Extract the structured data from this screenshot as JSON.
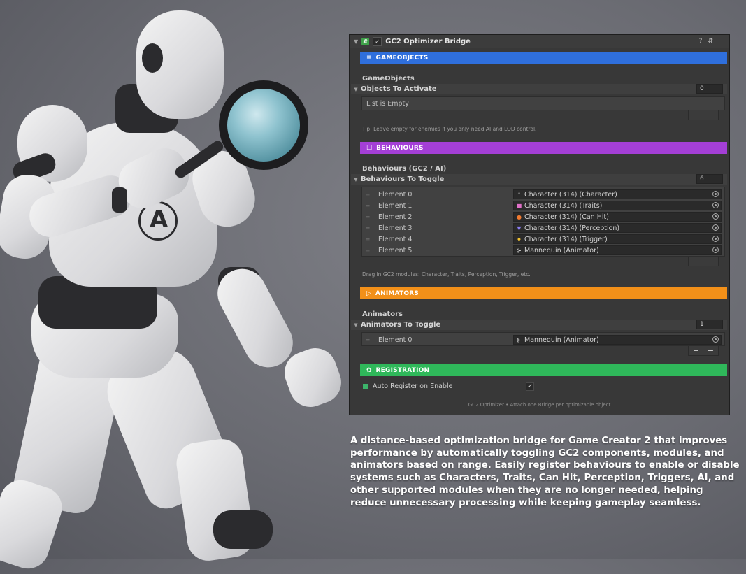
{
  "component": {
    "title": "GC2 Optimizer Bridge",
    "header_icons": [
      "help-icon",
      "preset-icon",
      "more-icon"
    ]
  },
  "sections": {
    "gameobjects": {
      "label": "GAMEOBJECTS",
      "icon": "list-icon",
      "color": "#2f6fdc"
    },
    "behaviours": {
      "label": "BEHAVIOURS",
      "icon": "square-icon",
      "color": "#a43fd6"
    },
    "animators": {
      "label": "ANIMATORS",
      "icon": "play-icon",
      "color": "#f29019"
    },
    "registration": {
      "label": "REGISTRATION",
      "icon": "gear-icon",
      "color": "#2fb85a"
    }
  },
  "gameobjects": {
    "heading": "GameObjects",
    "list_label": "Objects To Activate",
    "count": "0",
    "empty_text": "List is Empty",
    "tip": "Tip: Leave empty for enemies if you only need AI and LOD control."
  },
  "behaviours": {
    "heading": "Behaviours (GC2 / AI)",
    "list_label": "Behaviours To Toggle",
    "count": "6",
    "items": [
      {
        "name": "Element 0",
        "value": "Character (314) (Character)",
        "icon": "character-icon",
        "glyph": "☨",
        "color": "#dcdcdc"
      },
      {
        "name": "Element 1",
        "value": "Character (314) (Traits)",
        "icon": "traits-icon",
        "glyph": "■",
        "color": "#e070c8"
      },
      {
        "name": "Element 2",
        "value": "Character (314) (Can Hit)",
        "icon": "can-hit-icon",
        "glyph": "●",
        "color": "#f07a30"
      },
      {
        "name": "Element 3",
        "value": "Character (314) (Perception)",
        "icon": "perception-icon",
        "glyph": "▼",
        "color": "#8a7cf0"
      },
      {
        "name": "Element 4",
        "value": "Character (314) (Trigger)",
        "icon": "trigger-icon",
        "glyph": "♦",
        "color": "#f2c230"
      },
      {
        "name": "Element 5",
        "value": "Mannequin (Animator)",
        "icon": "animator-icon",
        "glyph": "⊱",
        "color": "#d0d0d0"
      }
    ],
    "tip": "Drag in GC2 modules: Character, Traits, Perception, Trigger, etc."
  },
  "animators": {
    "heading": "Animators",
    "list_label": "Animators To Toggle",
    "count": "1",
    "items": [
      {
        "name": "Element 0",
        "value": "Mannequin (Animator)",
        "icon": "animator-icon",
        "glyph": "⊱",
        "color": "#d0d0d0"
      }
    ]
  },
  "registration": {
    "auto_register_label": "Auto Register on Enable",
    "auto_register_checked": true
  },
  "footer": "GC2 Optimizer  •  Attach one Bridge per optimizable object",
  "description": "A distance-based optimization bridge for Game Creator 2 that improves performance by automatically toggling GC2 components, modules, and animators based on range. Easily register behaviours to enable or disable systems such as Characters, Traits, Can Hit, Perception, Triggers, AI, and other supported modules when they are no longer needed, helping reduce unnecessary processing while keeping gameplay seamless."
}
